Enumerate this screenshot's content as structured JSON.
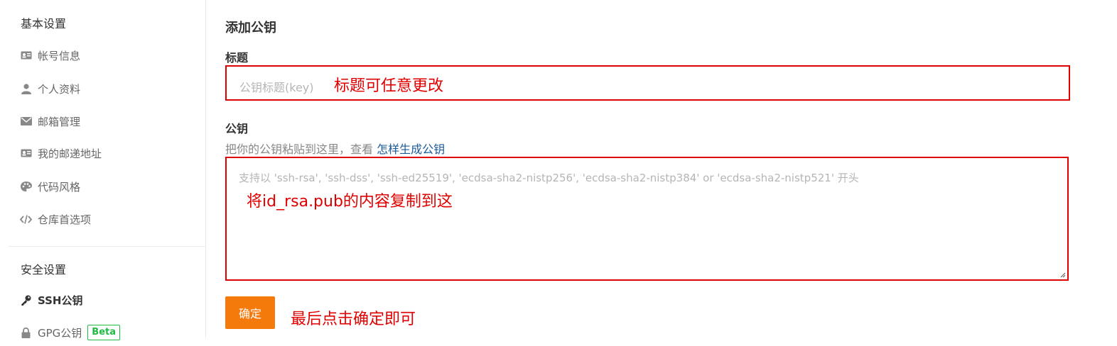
{
  "sidebar": {
    "basic_heading": "基本设置",
    "basic_items": [
      {
        "label": "帐号信息",
        "icon": "id-card-icon"
      },
      {
        "label": "个人资料",
        "icon": "user-icon"
      },
      {
        "label": "邮箱管理",
        "icon": "envelope-icon"
      },
      {
        "label": "我的邮递地址",
        "icon": "address-card-icon"
      },
      {
        "label": "代码风格",
        "icon": "palette-icon"
      },
      {
        "label": "仓库首选项",
        "icon": "code-icon"
      }
    ],
    "security_heading": "安全设置",
    "security_items": [
      {
        "label": "SSH公钥",
        "icon": "key-icon",
        "active": true
      },
      {
        "label": "GPG公钥",
        "icon": "lock-icon",
        "badge": "Beta"
      }
    ]
  },
  "main": {
    "section_title": "添加公钥",
    "title_label": "标题",
    "title_placeholder": "公钥标题(key)",
    "title_note": "标题可任意更改",
    "key_label": "公钥",
    "help_text": "把你的公钥粘贴到这里，查看 ",
    "help_link": "怎样生成公钥",
    "key_placeholder": "支持以 'ssh-rsa', 'ssh-dss', 'ssh-ed25519', 'ecdsa-sha2-nistp256', 'ecdsa-sha2-nistp384' or 'ecdsa-sha2-nistp521' 开头",
    "key_note": "将id_rsa.pub的内容复制到这",
    "confirm_label": "确定",
    "confirm_note": "最后点击确定即可"
  },
  "colors": {
    "annotation_red": "#e00000",
    "confirm_orange": "#f57a0c",
    "link_blue": "#1a5a9a",
    "beta_green": "#21ba45"
  }
}
